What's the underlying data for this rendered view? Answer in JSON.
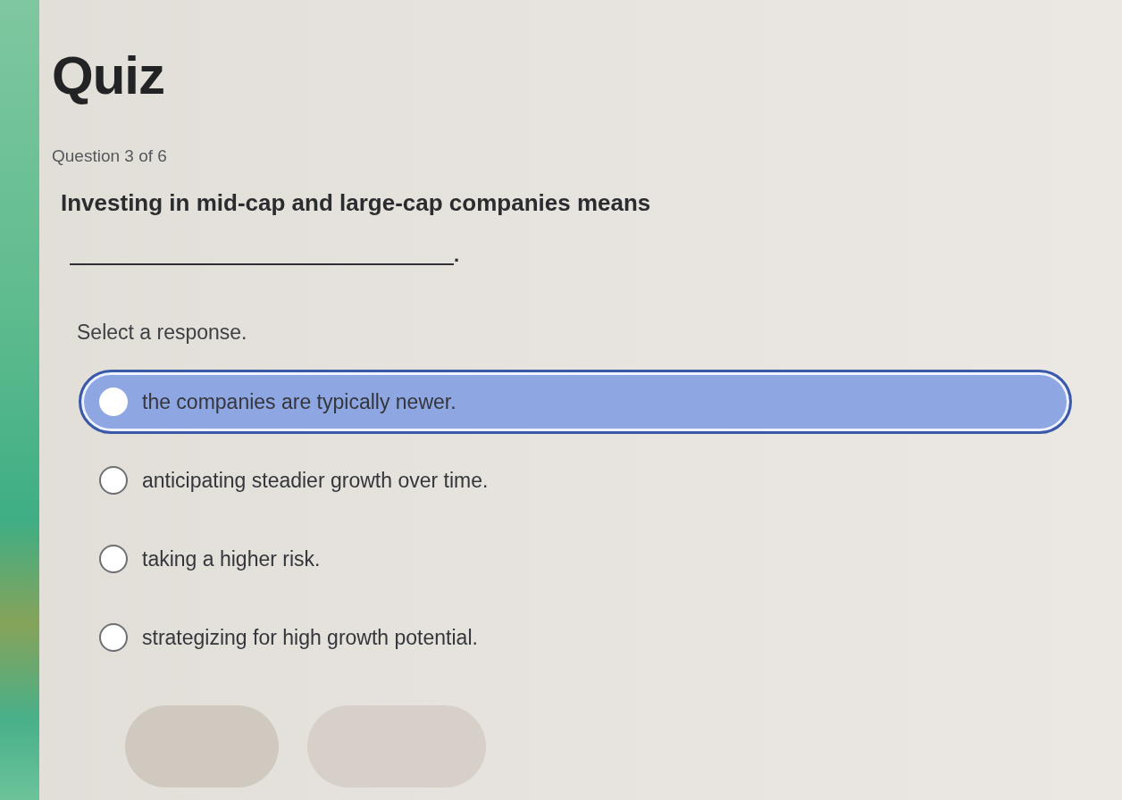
{
  "title": "Quiz",
  "progress": "Question 3 of 6",
  "question": {
    "text": "Investing in mid-cap and large-cap companies means",
    "after_blank": "."
  },
  "instruction": "Select a response.",
  "options": [
    {
      "label": "the companies are typically newer.",
      "selected": true
    },
    {
      "label": "anticipating steadier growth over time.",
      "selected": false
    },
    {
      "label": "taking a higher risk.",
      "selected": false
    },
    {
      "label": "strategizing for high growth potential.",
      "selected": false
    }
  ],
  "buttons": [
    {
      "disabled": true
    },
    {
      "disabled": true
    }
  ]
}
